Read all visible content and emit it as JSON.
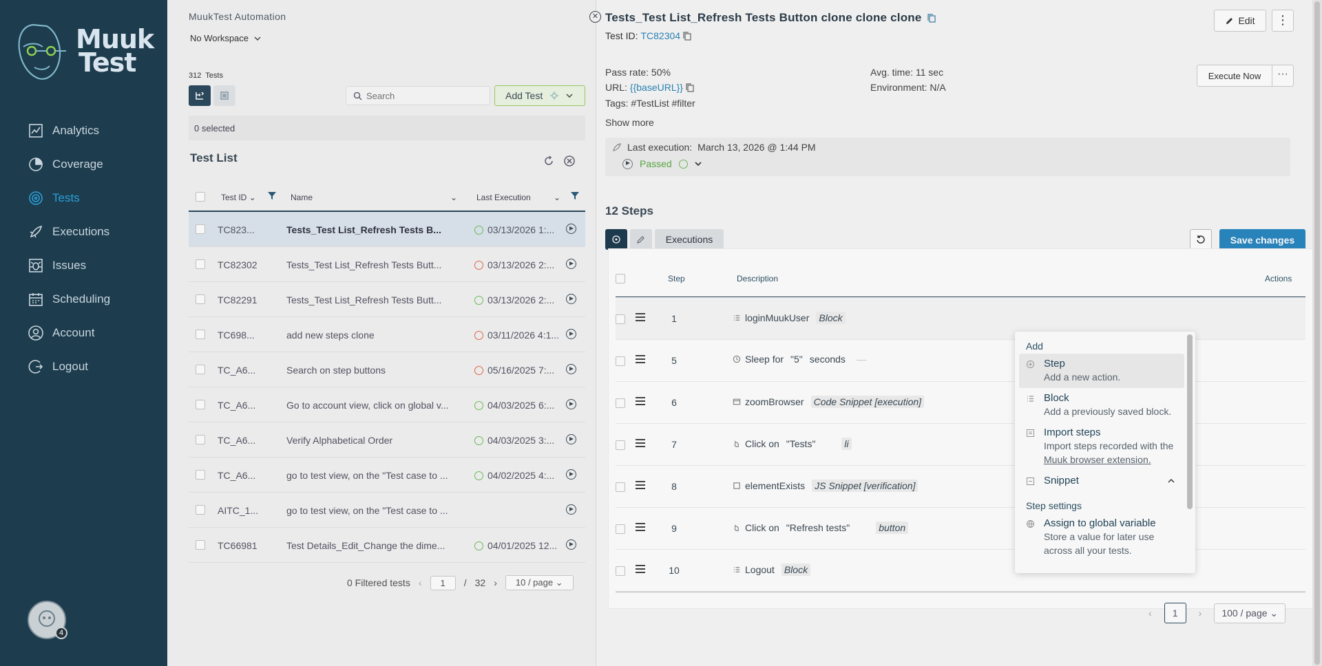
{
  "brand": {
    "logo_line1": "Muuk",
    "logo_line2": "Test"
  },
  "nav": [
    {
      "label": "Analytics",
      "icon": "analytics-icon"
    },
    {
      "label": "Coverage",
      "icon": "coverage-icon"
    },
    {
      "label": "Tests",
      "icon": "tests-icon",
      "active": true
    },
    {
      "label": "Executions",
      "icon": "rocket-icon"
    },
    {
      "label": "Issues",
      "icon": "bug-icon"
    },
    {
      "label": "Scheduling",
      "icon": "calendar-icon"
    },
    {
      "label": "Account",
      "icon": "user-icon"
    },
    {
      "label": "Logout",
      "icon": "logout-icon"
    }
  ],
  "user": {
    "badge": "4"
  },
  "workspace": {
    "app_name": "MuukTest Automation",
    "selected": "No Workspace"
  },
  "tests_count": {
    "number": "312",
    "label": "Tests"
  },
  "search": {
    "placeholder": "Search"
  },
  "add_test": {
    "label": "Add Test"
  },
  "selected_label": "0 selected",
  "test_list": {
    "title": "Test List",
    "columns": {
      "id": "Test ID",
      "name": "Name",
      "last_execution": "Last Execution"
    },
    "rows": [
      {
        "id": "TC823...",
        "name": "Tests_Test List_Refresh Tests B...",
        "status": "passed",
        "date": "03/13/2026 1:..."
      },
      {
        "id": "TC82302",
        "name": "Tests_Test List_Refresh Tests Butt...",
        "status": "failed",
        "date": "03/13/2026 2:..."
      },
      {
        "id": "TC82291",
        "name": "Tests_Test List_Refresh Tests Butt...",
        "status": "passed",
        "date": "03/13/2026 2:..."
      },
      {
        "id": "TC698...",
        "name": "add new steps clone",
        "status": "failed",
        "date": "03/11/2026 4:1..."
      },
      {
        "id": "TC_A6...",
        "name": "Search on step buttons",
        "status": "failed",
        "date": "05/16/2025 7:..."
      },
      {
        "id": "TC_A6...",
        "name": "Go to account view, click on global v...",
        "status": "passed",
        "date": "04/03/2025 6:..."
      },
      {
        "id": "TC_A6...",
        "name": "Verify Alphabetical Order",
        "status": "passed",
        "date": "04/03/2025 3:..."
      },
      {
        "id": "TC_A6...",
        "name": "go to test view, on the \"Test case to ...",
        "status": "passed",
        "date": "04/02/2025 4:..."
      },
      {
        "id": "AITC_1...",
        "name": "go to test view, on the \"Test case to ...",
        "status": "none",
        "date": ""
      },
      {
        "id": "TC66981",
        "name": "Test Details_Edit_Change the dime...",
        "status": "passed",
        "date": "04/01/2025 12..."
      }
    ],
    "pager": {
      "filtered": "0 Filtered tests",
      "page": "1",
      "sep": "/",
      "total": "32",
      "size": "10 / page"
    }
  },
  "detail": {
    "title": "Tests_Test List_Refresh Tests Button clone clone clone",
    "test_id_label": "Test ID:",
    "test_id": "TC82304",
    "edit_label": "Edit",
    "pass_rate": "Pass rate: 50%",
    "url_label": "URL:",
    "url_value": "{{baseURL}}",
    "tags": "Tags: #TestList #filter",
    "show_more": "Show more",
    "avg_time": "Avg. time: 11 sec",
    "environment": "Environment: N/A",
    "execute_now": "Execute Now",
    "last_execution_label": "Last execution:",
    "last_execution_value": "March 13, 2026 @ 1:44 PM",
    "last_status": "Passed",
    "steps_title": "12 Steps",
    "executions_tab": "Executions",
    "save_changes": "Save changes"
  },
  "steps": {
    "columns": {
      "step": "Step",
      "description": "Description",
      "actions": "Actions"
    },
    "rows": [
      {
        "num": "1",
        "icon": "list-icon",
        "parts": [
          "loginMuukUser"
        ],
        "tag": "Block",
        "suffix": ""
      },
      {
        "num": "5",
        "icon": "clock-icon",
        "parts": [
          "Sleep for",
          "\"5\"",
          "seconds"
        ],
        "tag": "",
        "suffix": "—"
      },
      {
        "num": "6",
        "icon": "window-icon",
        "parts": [
          "zoomBrowser"
        ],
        "tag": "Code Snippet [execution]",
        "suffix": ""
      },
      {
        "num": "7",
        "icon": "click-icon",
        "parts": [
          "Click on",
          "\"Tests\""
        ],
        "tag": "li",
        "suffix": ""
      },
      {
        "num": "8",
        "icon": "square-icon",
        "parts": [
          "elementExists"
        ],
        "tag": "JS Snippet [verification]",
        "suffix": ""
      },
      {
        "num": "9",
        "icon": "click-icon",
        "parts": [
          "Click on",
          "\"Refresh tests\""
        ],
        "tag": "button",
        "suffix": ""
      },
      {
        "num": "10",
        "icon": "list-icon",
        "parts": [
          "Logout"
        ],
        "tag": "Block",
        "suffix": ""
      }
    ],
    "pager": {
      "page": "1",
      "size": "100 / page"
    }
  },
  "add_menu": {
    "section_add": "Add",
    "items": [
      {
        "label": "Step",
        "sub": "Add a new action.",
        "icon": "plus-circle-icon",
        "highlighted": true
      },
      {
        "label": "Block",
        "sub": "Add a previously saved block.",
        "icon": "list-icon"
      },
      {
        "label": "Import steps",
        "sub": "Import steps recorded with the",
        "link": "Muuk browser extension.",
        "icon": "import-icon"
      },
      {
        "label": "Snippet",
        "sub": "",
        "icon": "snippet-icon",
        "chevron": true
      }
    ],
    "section_settings": "Step settings",
    "settings_items": [
      {
        "label": "Assign to global variable",
        "sub": "Store a value for later use across all your tests.",
        "icon": "globe-icon"
      }
    ]
  },
  "colors": {
    "sidebar": "#1d3c4d",
    "accent": "#2a88c2",
    "active_nav": "#2ba0dc",
    "passed": "#6cbf5a",
    "failed": "#e46a4a"
  }
}
